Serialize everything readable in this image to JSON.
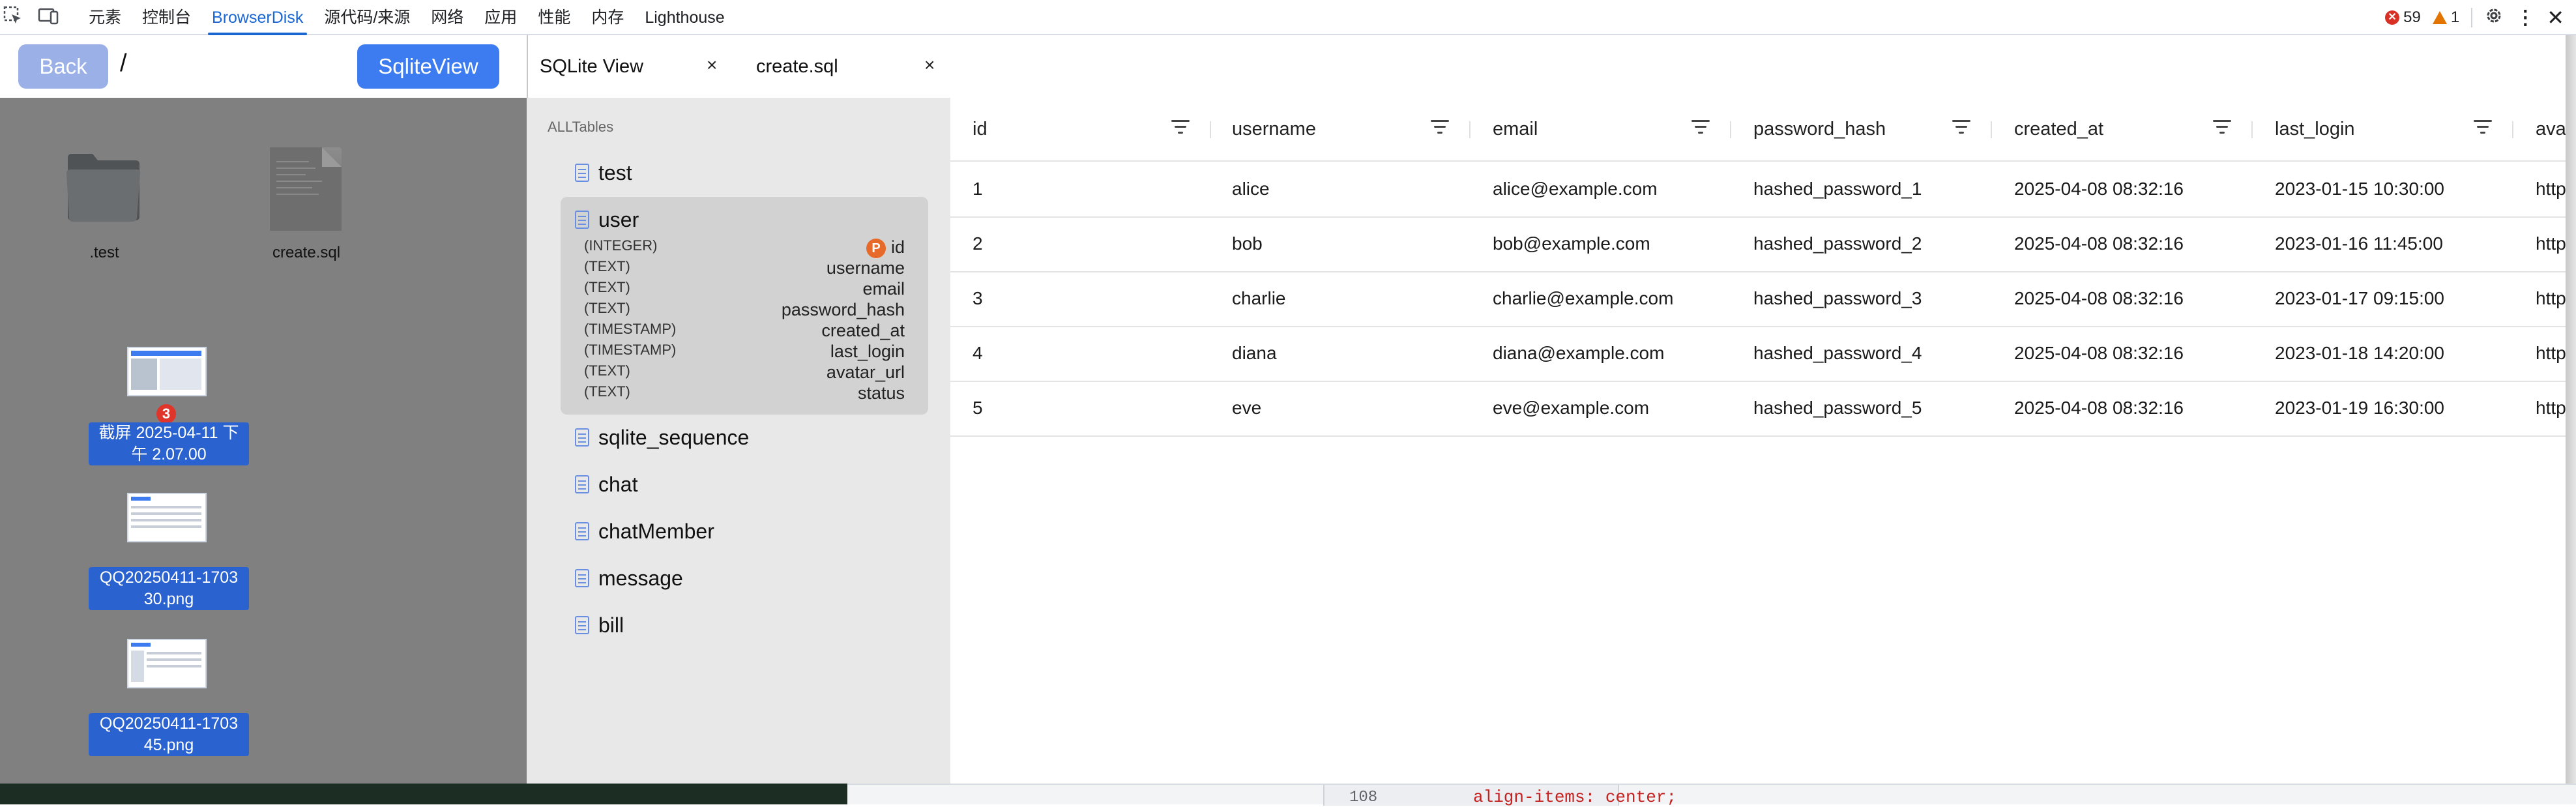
{
  "devtools": {
    "tabs": [
      "元素",
      "控制台",
      "BrowserDisk",
      "源代码/来源",
      "网络",
      "应用",
      "性能",
      "内存",
      "Lighthouse"
    ],
    "active_tab": "BrowserDisk",
    "errors": "59",
    "warnings": "1",
    "colors": {
      "error": "#d93025",
      "warning": "#e37400",
      "active_tab": "#1a67d2"
    }
  },
  "disk": {
    "back_label": "Back",
    "path": "/",
    "sqlite_button": "SqliteView",
    "files": [
      {
        "name": ".test",
        "icon": "folder-icon"
      },
      {
        "name": "create.sql",
        "icon": "document-icon"
      }
    ],
    "screenshots": [
      {
        "name_line1": "截屏 2025-04-11 下",
        "name_line2": "午 2.07.00",
        "badge": "3"
      },
      {
        "name_line1": "QQ20250411-1703",
        "name_line2": "30.png"
      },
      {
        "name_line1": "QQ20250411-1703",
        "name_line2": "45.png"
      }
    ]
  },
  "editor_tabs": [
    {
      "label": "SQLite View",
      "close": "×"
    },
    {
      "label": "create.sql",
      "close": "×"
    }
  ],
  "tables": {
    "header": "ALLTables",
    "items": [
      "test",
      "user",
      "sqlite_sequence",
      "chat",
      "chatMember",
      "message",
      "bill"
    ],
    "pk_badge": "P",
    "user_columns": [
      {
        "type": "(INTEGER)",
        "name": "id"
      },
      {
        "type": "(TEXT)",
        "name": "username"
      },
      {
        "type": "(TEXT)",
        "name": "email"
      },
      {
        "type": "(TEXT)",
        "name": "password_hash"
      },
      {
        "type": "(TIMESTAMP)",
        "name": "created_at"
      },
      {
        "type": "(TIMESTAMP)",
        "name": "last_login"
      },
      {
        "type": "(TEXT)",
        "name": "avatar_url"
      },
      {
        "type": "(TEXT)",
        "name": "status"
      }
    ]
  },
  "grid": {
    "columns": [
      "id",
      "username",
      "email",
      "password_hash",
      "created_at",
      "last_login",
      "avat"
    ],
    "rows": [
      [
        "1",
        "alice",
        "alice@example.com",
        "hashed_password_1",
        "2025-04-08 08:32:16",
        "2023-01-15 10:30:00",
        "http"
      ],
      [
        "2",
        "bob",
        "bob@example.com",
        "hashed_password_2",
        "2025-04-08 08:32:16",
        "2023-01-16 11:45:00",
        "http"
      ],
      [
        "3",
        "charlie",
        "charlie@example.com",
        "hashed_password_3",
        "2025-04-08 08:32:16",
        "2023-01-17 09:15:00",
        "http"
      ],
      [
        "4",
        "diana",
        "diana@example.com",
        "hashed_password_4",
        "2025-04-08 08:32:16",
        "2023-01-18 14:20:00",
        "http"
      ],
      [
        "5",
        "eve",
        "eve@example.com",
        "hashed_password_5",
        "2025-04-08 08:32:16",
        "2023-01-19 16:30:00",
        "http"
      ]
    ]
  },
  "background_editor": {
    "line_number": "108",
    "code": "align-items: center;"
  }
}
